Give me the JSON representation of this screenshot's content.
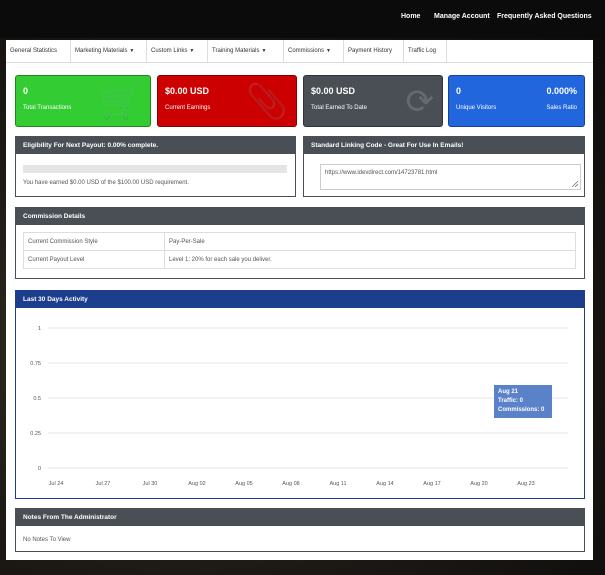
{
  "topnav": {
    "home": "Home",
    "manage_account": "Manage Account",
    "faq": "Frequently Asked Questions"
  },
  "tabs": [
    {
      "label": "General Statistics",
      "dropdown": false
    },
    {
      "label": "Marketing Materials",
      "dropdown": true
    },
    {
      "label": "Custom Links",
      "dropdown": true
    },
    {
      "label": "Training Materials",
      "dropdown": true
    },
    {
      "label": "Commissions",
      "dropdown": true
    },
    {
      "label": "Payment History",
      "dropdown": false
    },
    {
      "label": "Traffic Log",
      "dropdown": false
    }
  ],
  "stats": [
    {
      "value": "0",
      "label": "Total Transactions",
      "color": "#33cc33",
      "icon": "cart-icon"
    },
    {
      "value": "$0.00 USD",
      "label": "Current Earnings",
      "color": "#cc0000",
      "icon": "paperclip-icon"
    },
    {
      "value": "$0.00 USD",
      "label": "Total Earned To Date",
      "color": "#4a4f55",
      "icon": "refresh-icon"
    },
    {
      "value": "0",
      "label": "Unique Visitors",
      "value2": "0.000%",
      "label2": "Sales Ratio",
      "color": "#2266dd",
      "icon": "user-icon"
    }
  ],
  "eligibility": {
    "title": "Eligibility For Next Payout: 0.00% complete.",
    "progress": 0.0,
    "text": "You have earned $0.00 USD of the $100.00 USD requirement."
  },
  "linking": {
    "title": "Standard Linking Code - Great For Use In Emails!",
    "url": "https://www.idevdirect.com/14723781.html"
  },
  "commission": {
    "title": "Commission Details",
    "rows": [
      [
        "Current Commission Style",
        "Pay-Per-Sale"
      ],
      [
        "Current Payout Level",
        "Level 1: 20% for each sale you deliver."
      ]
    ]
  },
  "activity": {
    "title": "Last 30 Days Activity",
    "tooltip": {
      "date": "Aug 21",
      "traffic": "Traffic: 0",
      "commissions": "Commissions: 0"
    }
  },
  "chart_data": {
    "type": "line",
    "title": "Last 30 Days Activity",
    "x_ticks": [
      "Jul 24",
      "Jul 27",
      "Jul 30",
      "Aug 02",
      "Aug 05",
      "Aug 08",
      "Aug 11",
      "Aug 14",
      "Aug 17",
      "Aug 20",
      "Aug 23"
    ],
    "y_ticks": [
      "1",
      "0.75",
      "0.5",
      "0.25",
      "0"
    ],
    "ylim": [
      0,
      1
    ],
    "grid": true,
    "series": [
      {
        "name": "Traffic",
        "values": [
          0,
          0,
          0,
          0,
          0,
          0,
          0,
          0,
          0,
          0,
          0
        ]
      },
      {
        "name": "Commissions",
        "values": [
          0,
          0,
          0,
          0,
          0,
          0,
          0,
          0,
          0,
          0,
          0
        ]
      }
    ]
  },
  "notes": {
    "title": "Notes From The Administrator",
    "text": "No Notes To View"
  }
}
